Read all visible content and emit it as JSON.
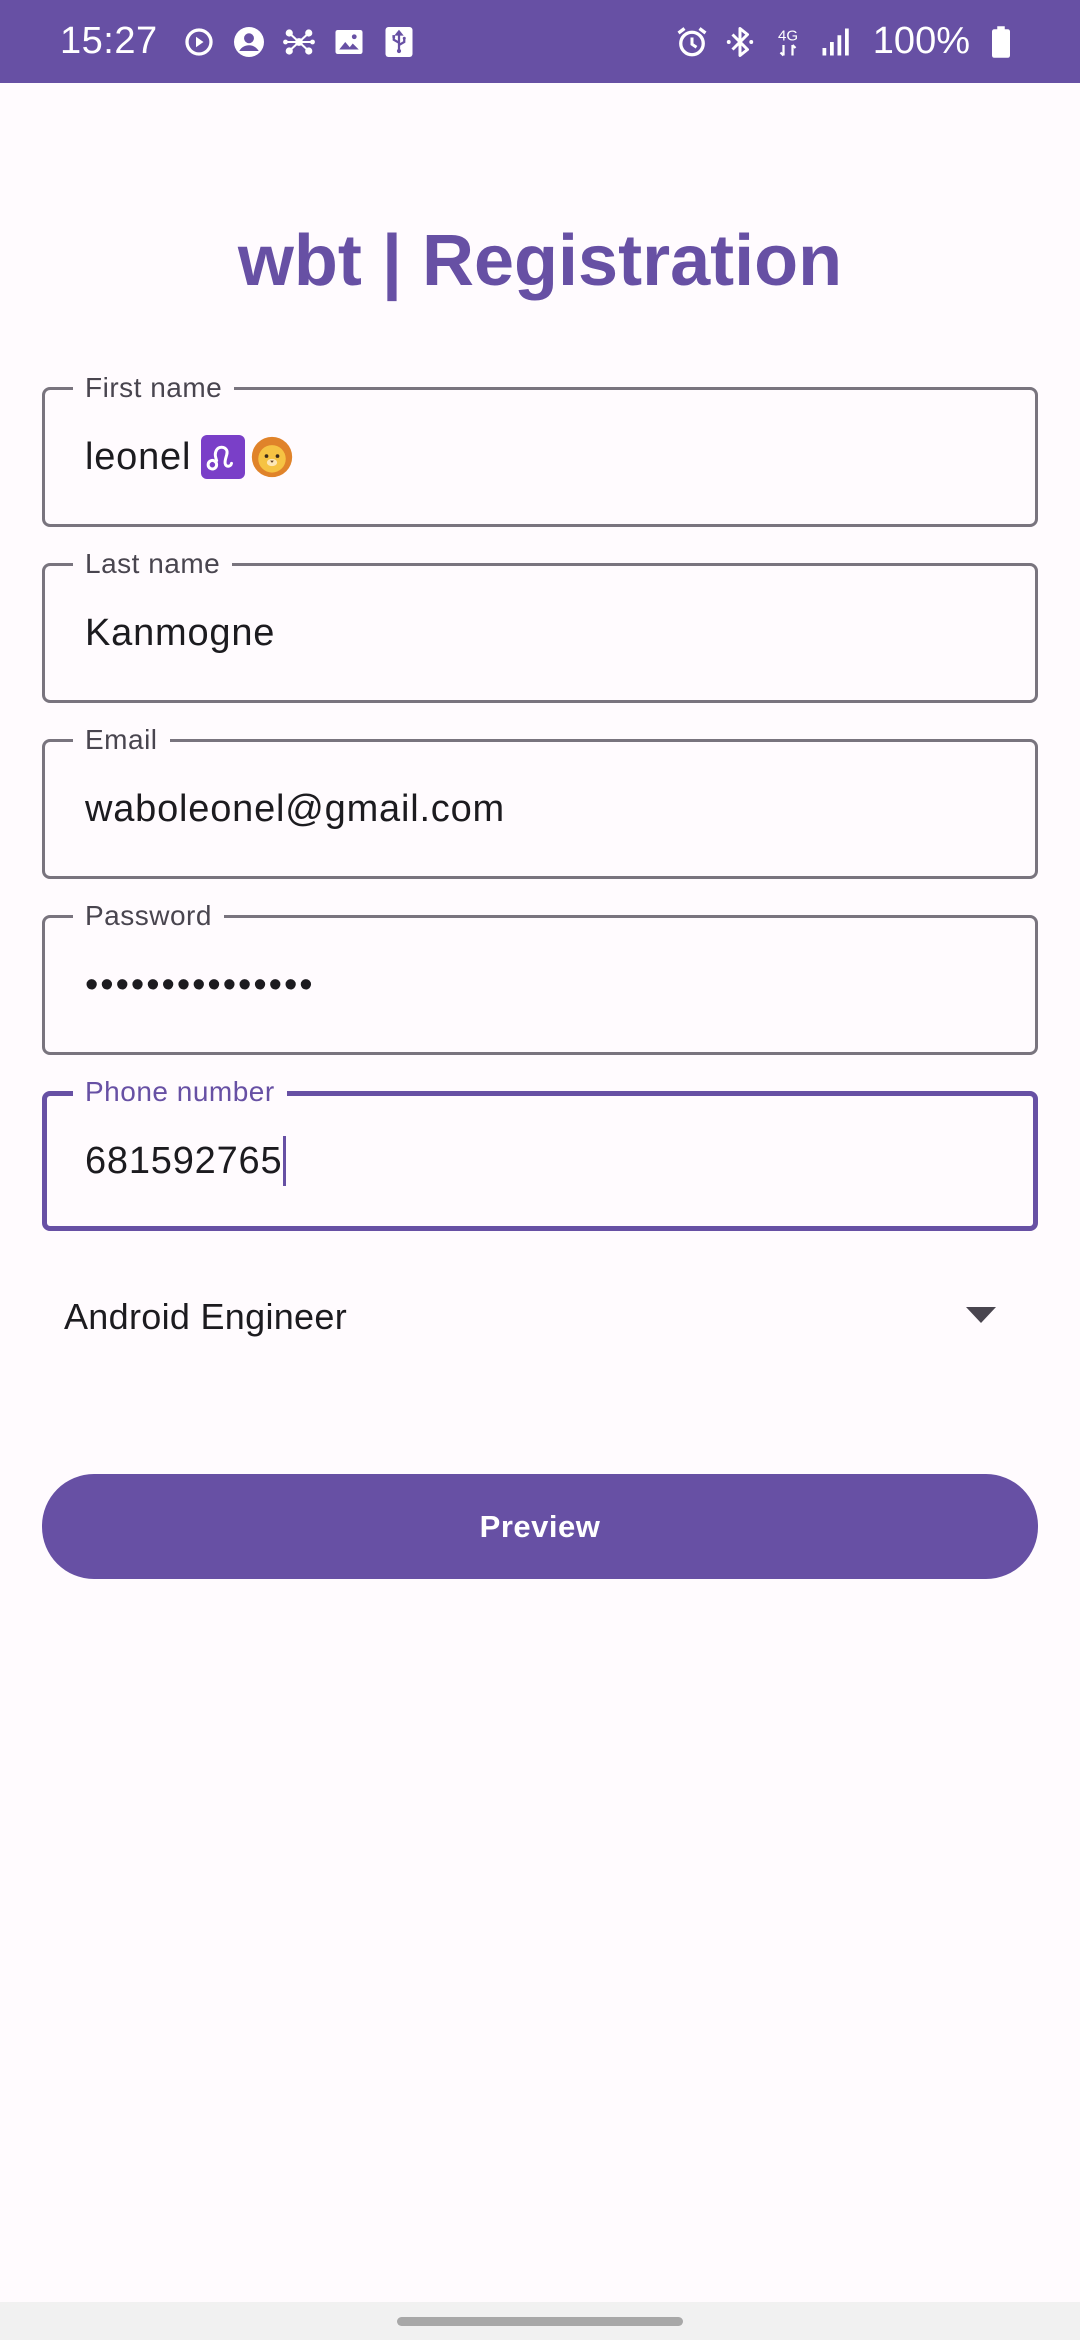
{
  "status_bar": {
    "time": "15:27",
    "battery": "100%",
    "network": "4G",
    "left_icons": [
      "sync-icon",
      "account-circle-icon",
      "hub-icon",
      "image-icon",
      "usb-icon"
    ],
    "right_icons": [
      "alarm-icon",
      "bluetooth-icon",
      "network-4g-icon",
      "signal-icon",
      "battery-icon"
    ]
  },
  "form": {
    "title": "wbt | Registration",
    "fields": [
      {
        "label": "First name",
        "value": "leonel",
        "emojis": [
          "♌",
          "🦁"
        ]
      },
      {
        "label": "Last name",
        "value": "Kanmogne"
      },
      {
        "label": "Email",
        "value": "waboleonel@gmail.com"
      },
      {
        "label": "Password",
        "value": "•••••••••••••••"
      },
      {
        "label": "Phone number",
        "value": "681592765"
      }
    ],
    "role_select": {
      "selected": "Android Engineer"
    },
    "preview_label": "Preview"
  },
  "colors": {
    "primary": "#6750a4",
    "background": "#fffbfe",
    "outline": "#79747e",
    "on_surface": "#1c1b1f"
  }
}
